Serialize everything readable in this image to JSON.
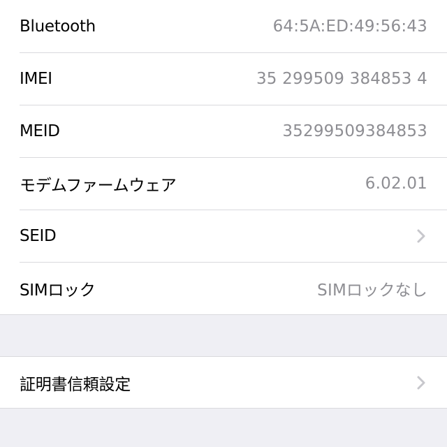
{
  "groups": [
    {
      "rows": [
        {
          "label": "Bluetooth",
          "value": "64:5A:ED:49:56:43"
        },
        {
          "label": "IMEI",
          "value": "35 299509 384853 4"
        },
        {
          "label": "MEID",
          "value": "35299509384853"
        },
        {
          "label": "モデムファームウェア",
          "value": "6.02.01"
        },
        {
          "label": "SEID",
          "accessory": "chevron-right-icon"
        },
        {
          "label": "SIMロック",
          "value": "SIMロックなし"
        }
      ]
    },
    {
      "rows": [
        {
          "label": "証明書信頼設定",
          "accessory": "chevron-right-icon"
        }
      ]
    }
  ],
  "colors": {
    "background": "#efeff4",
    "cell": "#ffffff",
    "separator": "#d9d9dd",
    "label": "#000000",
    "value": "#8e8e93",
    "chevron": "#c7c7cc"
  }
}
